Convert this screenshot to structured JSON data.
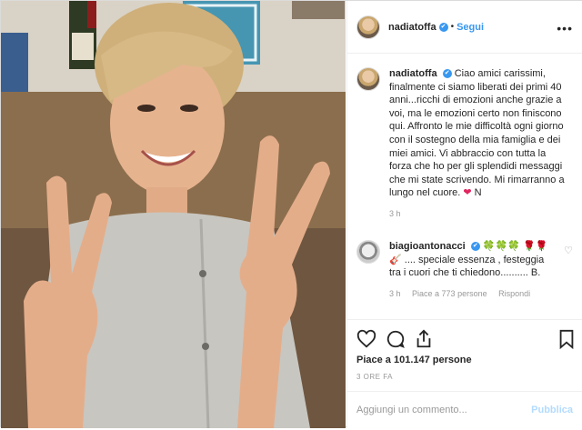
{
  "header": {
    "username": "nadiatoffa",
    "verified_mark": "✔",
    "separator": "•",
    "follow_label": "Segui",
    "more_label": "•••"
  },
  "caption": {
    "username": "nadiatoffa",
    "verified_mark": "✔",
    "text": "Ciao amici carissimi, finalmente ci siamo liberati dei primi 40 anni...ricchi di emozioni anche grazie a voi, ma le emozioni certo non finiscono qui. Affronto le mie difficoltà ogni giorno con il sostegno della mia famiglia e dei miei amici. Vi abbraccio con tutta la forza che ho per gli splendidi messaggi che mi state scrivendo. Mi rimarranno a lungo nel cuore.",
    "heart": "❤",
    "signoff": "N",
    "time": "3 h"
  },
  "comment": {
    "username": "biagioantonacci",
    "verified_mark": "✔",
    "emoji_clovers": "🍀🍀🍀",
    "emoji_flowers": "🌹🌹🎸",
    "text": ".... speciale essenza , festeggia tra i cuori che ti chiedono.......... B.",
    "time": "3 h",
    "likes": "Piace a 773 persone",
    "reply": "Rispondi",
    "heart": "♡"
  },
  "actions": {
    "likes": "Piace a 101.147 persone",
    "time": "3 ORE FA"
  },
  "add_comment": {
    "placeholder": "Aggiungi un commento...",
    "publish": "Pubblica"
  },
  "colors": {
    "link": "#3897f0",
    "heart": "#e0245e",
    "publish_disabled": "#b3dbff"
  }
}
